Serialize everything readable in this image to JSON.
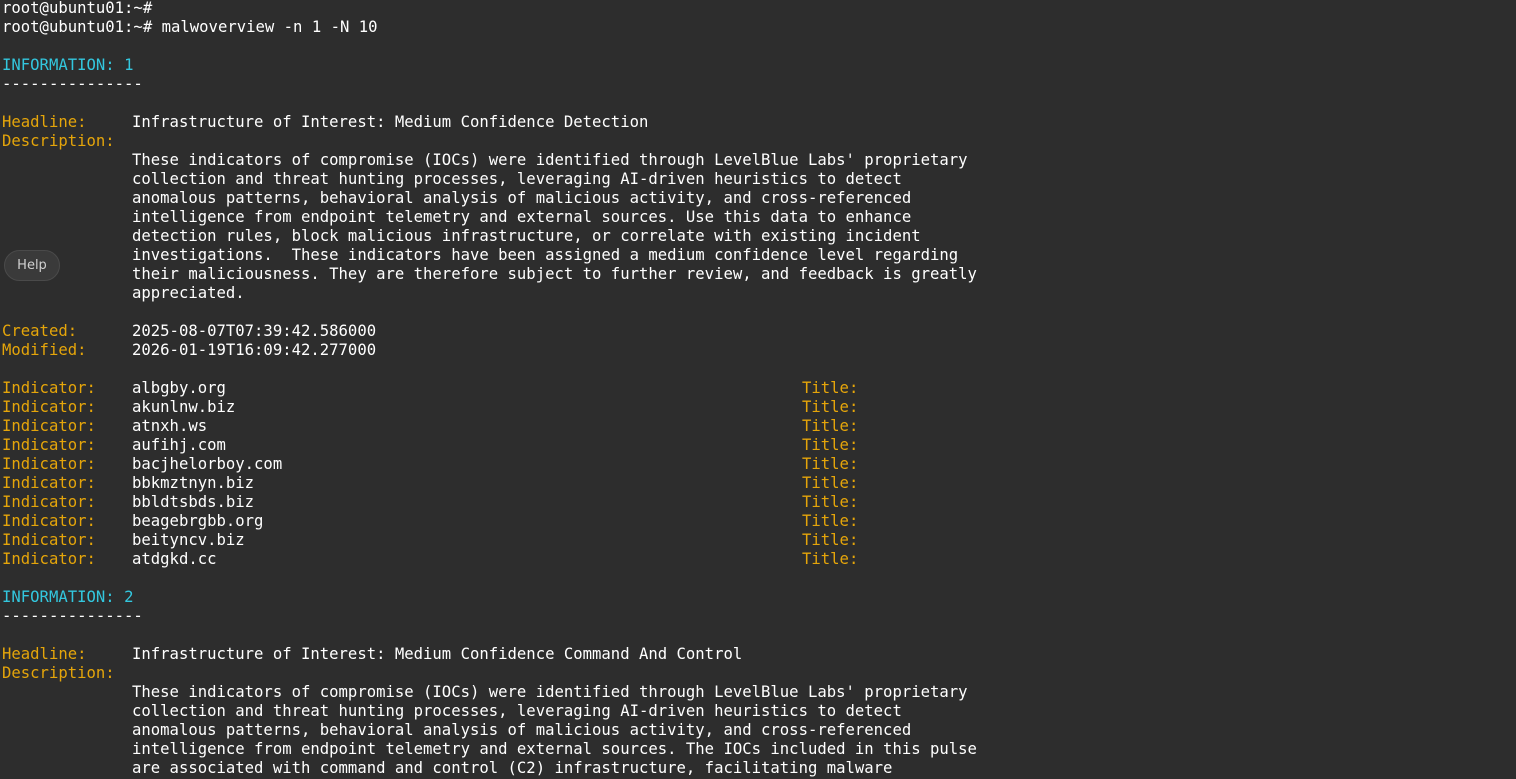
{
  "prompt": "root@ubuntu01:~#",
  "command": "malwoverview -n 1 -N 10",
  "labels": {
    "information": "INFORMATION:",
    "headline": "Headline:",
    "description": "Description:",
    "created": "Created:",
    "modified": "Modified:",
    "indicator": "Indicator:",
    "title": "Title:"
  },
  "separator": "---------------",
  "help_button": "Help",
  "entries": [
    {
      "number": "1",
      "headline": "Infrastructure of Interest: Medium Confidence Detection",
      "description_lines": [
        "These indicators of compromise (IOCs) were identified through LevelBlue Labs' proprietary",
        "collection and threat hunting processes, leveraging AI-driven heuristics to detect",
        "anomalous patterns, behavioral analysis of malicious activity, and cross-referenced",
        "intelligence from endpoint telemetry and external sources. Use this data to enhance",
        "detection rules, block malicious infrastructure, or correlate with existing incident",
        "investigations.  These indicators have been assigned a medium confidence level regarding",
        "their maliciousness. They are therefore subject to further review, and feedback is greatly",
        "appreciated."
      ],
      "created": "2025-08-07T07:39:42.586000",
      "modified": "2026-01-19T16:09:42.277000",
      "indicators": [
        "albgby.org",
        "akunlnw.biz",
        "atnxh.ws",
        "aufihj.com",
        "bacjhelorboy.com",
        "bbkmztnyn.biz",
        "bbldtsbds.biz",
        "beagebrgbb.org",
        "beityncv.biz",
        "atdgkd.cc"
      ]
    },
    {
      "number": "2",
      "headline": "Infrastructure of Interest: Medium Confidence Command And Control",
      "description_lines": [
        "These indicators of compromise (IOCs) were identified through LevelBlue Labs' proprietary",
        "collection and threat hunting processes, leveraging AI-driven heuristics to detect",
        "anomalous patterns, behavioral analysis of malicious activity, and cross-referenced",
        "intelligence from endpoint telemetry and external sources. The IOCs included in this pulse",
        "are associated with command and control (C2) infrastructure, facilitating malware"
      ]
    }
  ]
}
